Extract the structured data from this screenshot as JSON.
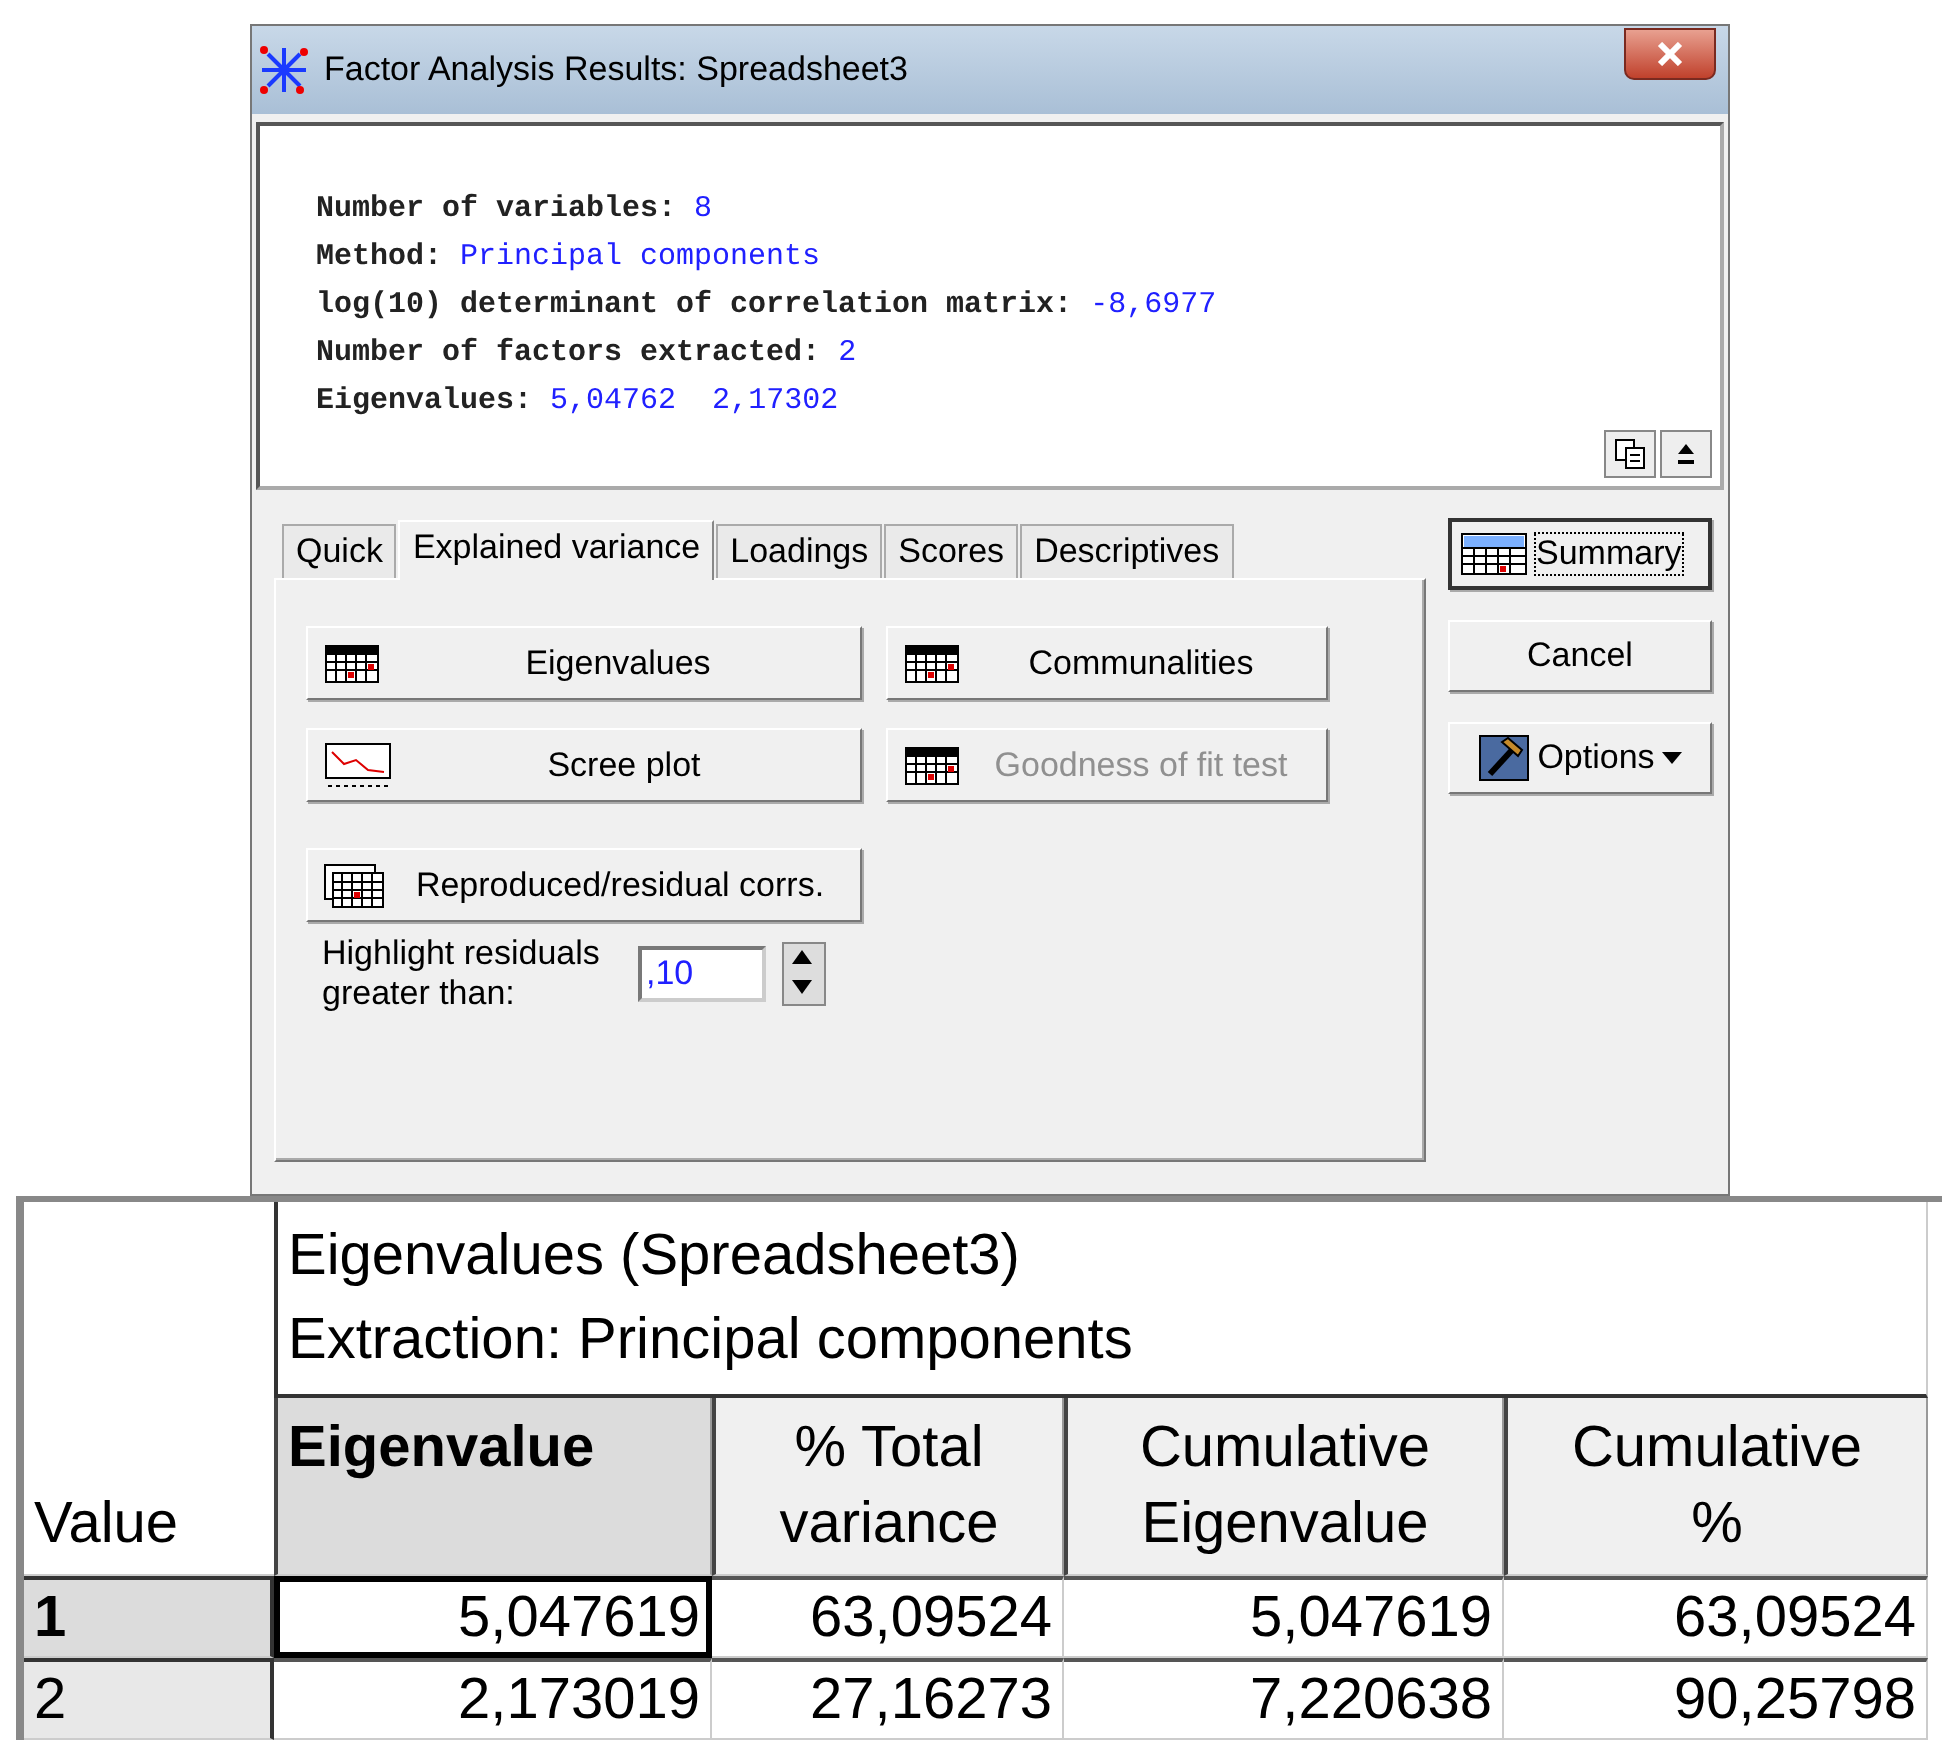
{
  "window": {
    "title": "Factor Analysis Results: Spreadsheet3"
  },
  "summary_lines": [
    {
      "label": "Number of variables:",
      "value": "8"
    },
    {
      "label": "Method:",
      "value": "Principal components"
    },
    {
      "label": "log(10) determinant of correlation matrix:",
      "value": "-8,6977"
    },
    {
      "label": "Number of factors extracted:",
      "value": "2"
    },
    {
      "label": "Eigenvalues:",
      "value": "5,04762  2,17302"
    }
  ],
  "tabs": [
    {
      "label": "Quick",
      "selected": false
    },
    {
      "label": "Explained variance",
      "selected": true
    },
    {
      "label": "Loadings",
      "selected": false
    },
    {
      "label": "Scores",
      "selected": false
    },
    {
      "label": "Descriptives",
      "selected": false
    }
  ],
  "buttons": [
    {
      "label": "Eigenvalues",
      "kind": "grid",
      "disabled": false
    },
    {
      "label": "Communalities",
      "kind": "grid",
      "disabled": false
    },
    {
      "label": "Scree plot",
      "kind": "plot",
      "disabled": false
    },
    {
      "label": "Goodness of fit test",
      "kind": "grid",
      "disabled": true
    },
    {
      "label": "Reproduced/residual corrs.",
      "kind": "stack",
      "disabled": false
    }
  ],
  "highlight": {
    "label": "Highlight residuals greater than:",
    "value": ",10"
  },
  "side_buttons": [
    {
      "label": "Summary",
      "kind": "summary"
    },
    {
      "label": "Cancel",
      "kind": "plain"
    },
    {
      "label": "Options",
      "kind": "menu"
    }
  ],
  "spreadsheet": {
    "title_lines": [
      "Eigenvalues (Spreadsheet3)",
      "Extraction: Principal components"
    ],
    "corner": "Value",
    "columns": [
      {
        "lines": [
          "Eigenvalue"
        ],
        "selected": true
      },
      {
        "lines": [
          "% Total",
          "variance"
        ],
        "selected": false
      },
      {
        "lines": [
          "Cumulative",
          "Eigenvalue"
        ],
        "selected": false
      },
      {
        "lines": [
          "Cumulative",
          "%"
        ],
        "selected": false
      }
    ],
    "rows": [
      {
        "label": "1",
        "selected": true,
        "cells": [
          {
            "text": "5,047619",
            "focused": true
          },
          {
            "text": "63,09524",
            "focused": false
          },
          {
            "text": "5,047619",
            "focused": false
          },
          {
            "text": "63,09524",
            "focused": false
          }
        ]
      },
      {
        "label": "2",
        "selected": false,
        "cells": [
          {
            "text": "2,173019",
            "focused": false
          },
          {
            "text": "27,16273",
            "focused": false
          },
          {
            "text": "7,220638",
            "focused": false
          },
          {
            "text": "90,25798",
            "focused": false
          }
        ]
      }
    ]
  }
}
